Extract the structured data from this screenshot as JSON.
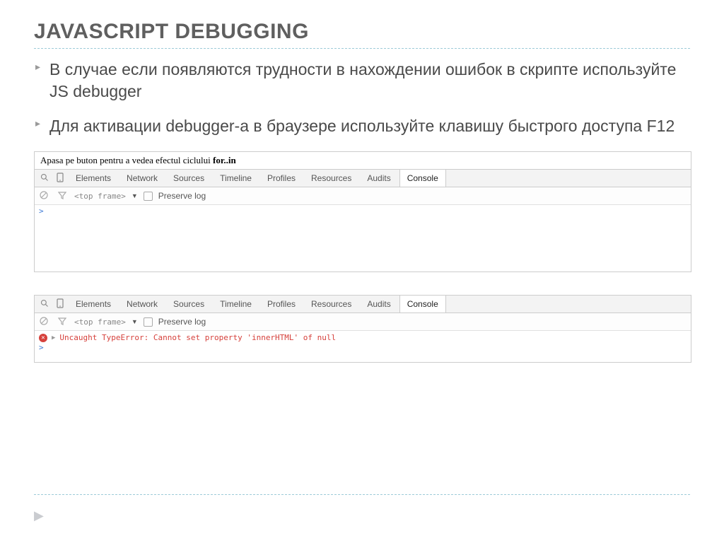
{
  "title": "JAVASCRIPT DEBUGGING",
  "bullets": {
    "b1": "В случае если появляются трудности в нахождении ошибок в скрипте используйте JS debugger",
    "b2": "Для активации debugger-а в браузере используйте клавишу быстрого доступа F12"
  },
  "webtext_prefix": "Apasa pe buton pentru a vedea efectul ciclului ",
  "webtext_bold": "for..in",
  "devtools": {
    "tabs": {
      "elements": "Elements",
      "network": "Network",
      "sources": "Sources",
      "timeline": "Timeline",
      "profiles": "Profiles",
      "resources": "Resources",
      "audits": "Audits",
      "console": "Console"
    },
    "frame": "<top frame>",
    "preserve": "Preserve log"
  },
  "error": "Uncaught TypeError: Cannot set property 'innerHTML' of null",
  "prompt": ">"
}
